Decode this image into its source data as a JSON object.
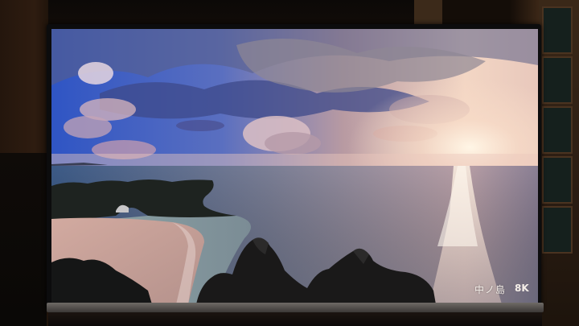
{
  "screen": {
    "watermark_title": "中ノ島",
    "watermark_subtitle": "",
    "resolution_badge": "8K"
  },
  "scene": {
    "description_icon": "seascape-sunset-image",
    "colors": {
      "sky_blue": "#3b63c8",
      "cloud_warm": "#c89a8a",
      "sun_glow": "#fff1dc",
      "sea": "#6f7d92",
      "sand": "#caa39a",
      "rock": "#1b1a1c"
    }
  }
}
